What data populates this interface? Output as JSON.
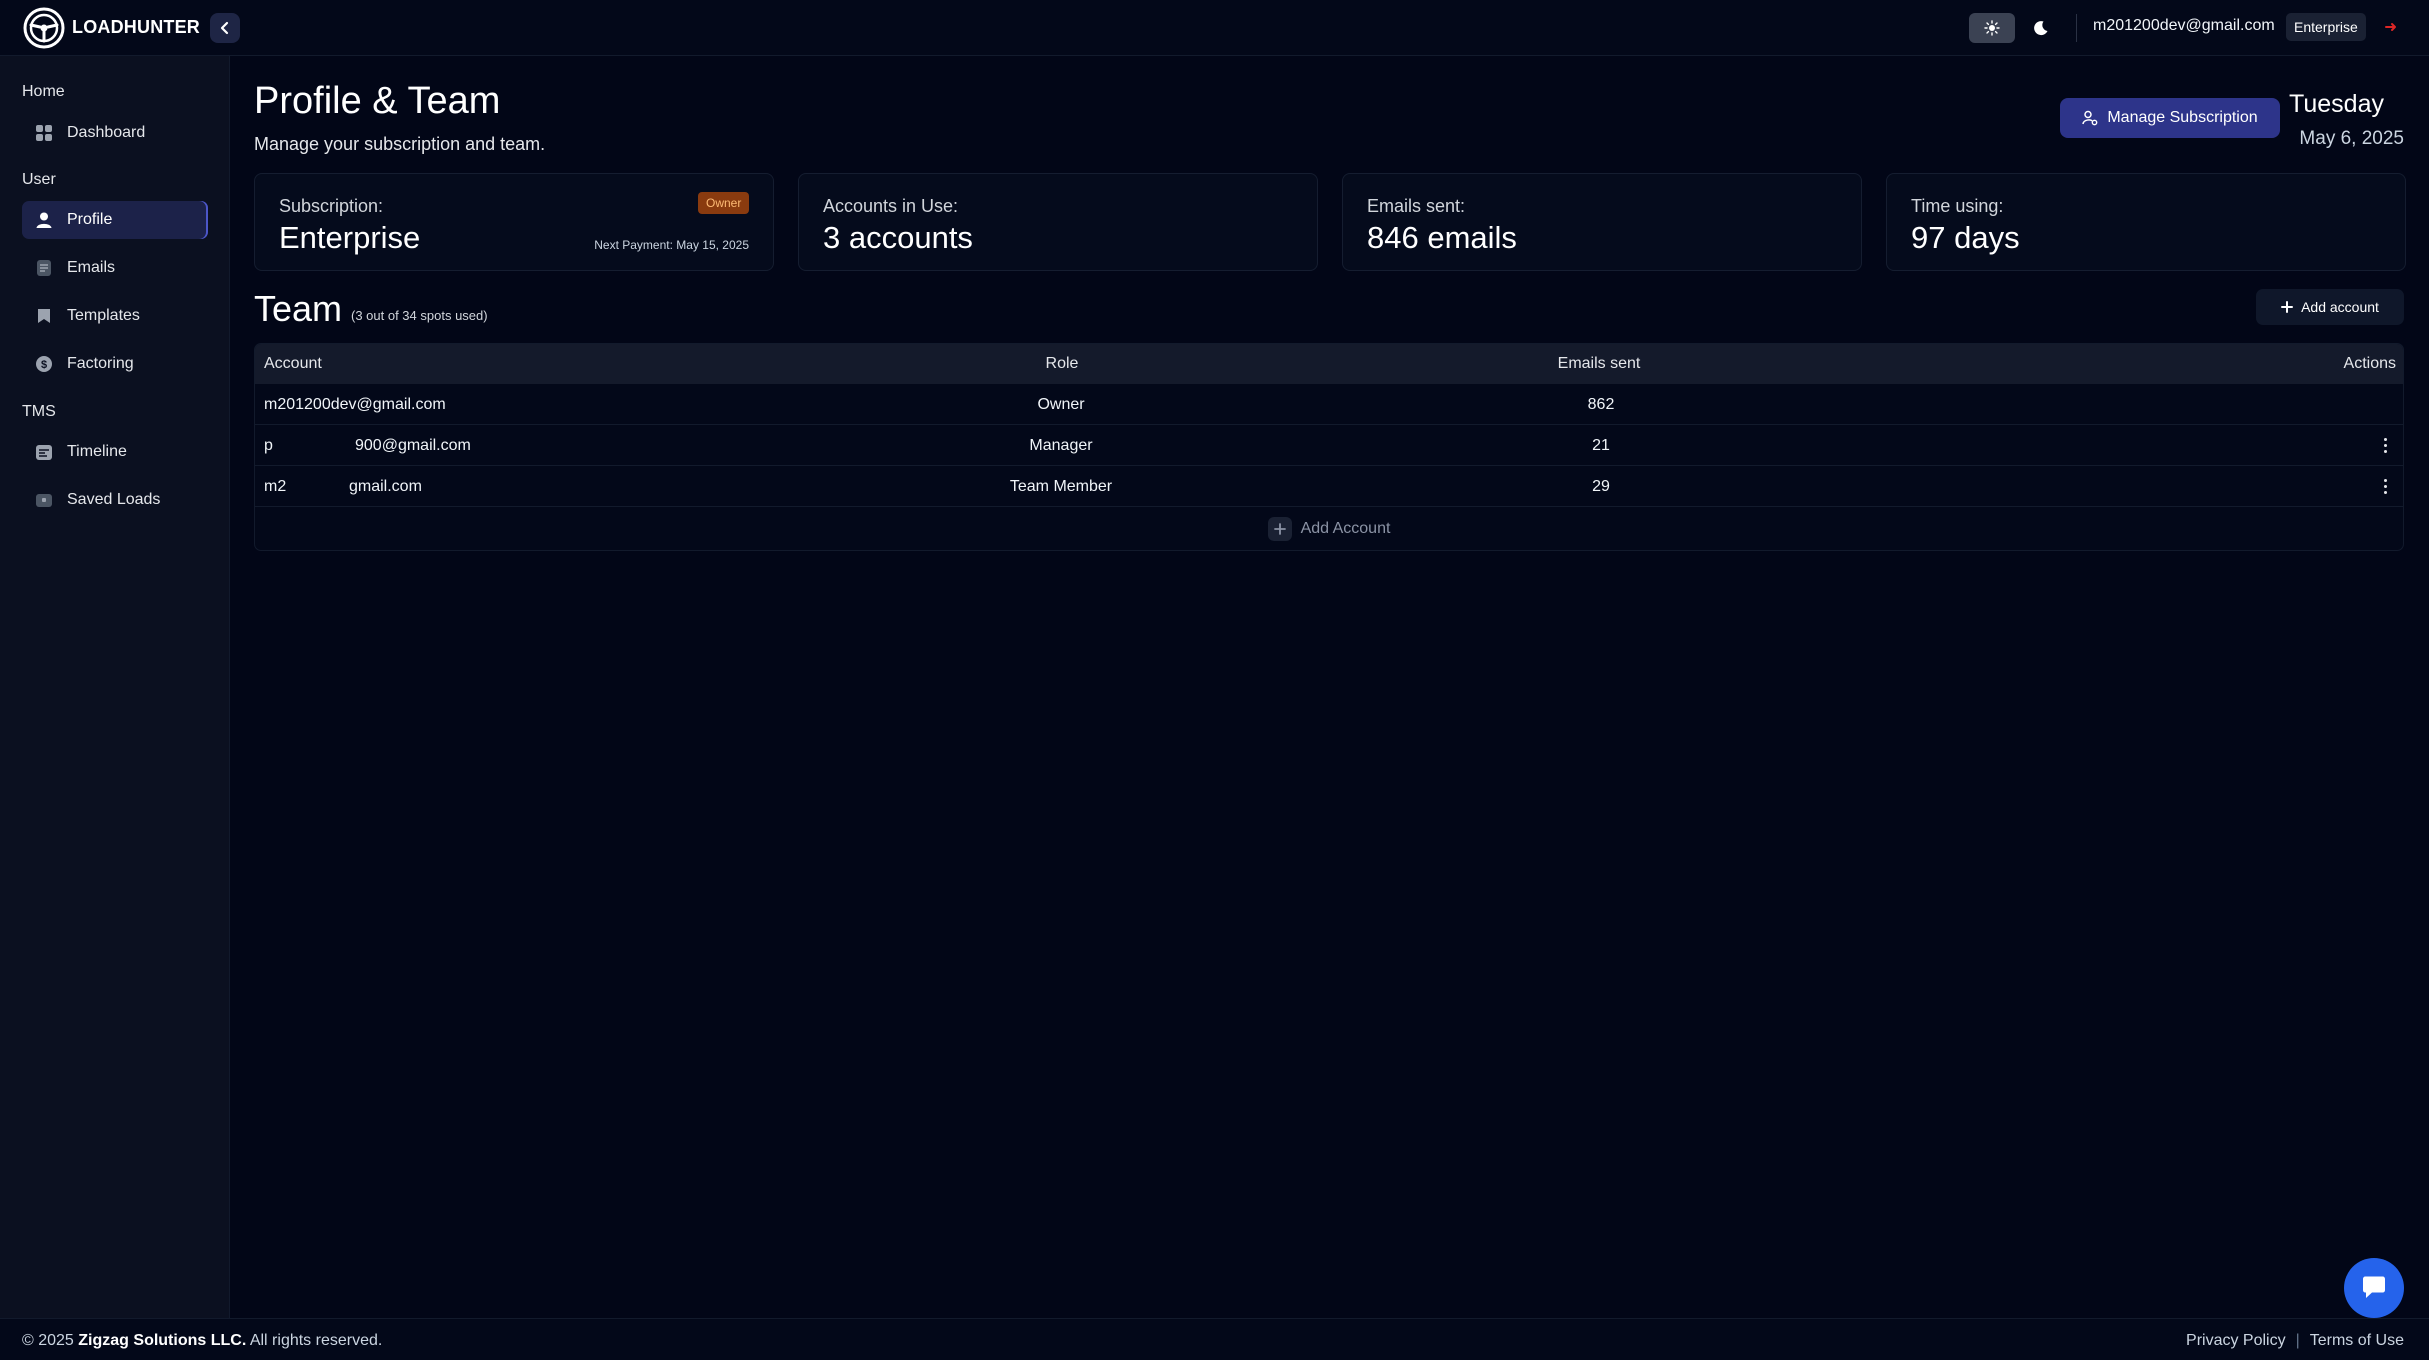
{
  "header": {
    "brand": "LOADHUNTER",
    "user_email": "m201200dev@gmail.com",
    "plan_badge": "Enterprise"
  },
  "sidebar": {
    "sections": [
      {
        "title": "Home",
        "items": [
          {
            "label": "Dashboard",
            "icon": "grid-icon"
          }
        ]
      },
      {
        "title": "User",
        "items": [
          {
            "label": "Profile",
            "icon": "person-icon",
            "active": true
          },
          {
            "label": "Emails",
            "icon": "document-icon"
          },
          {
            "label": "Templates",
            "icon": "bookmark-icon"
          },
          {
            "label": "Factoring",
            "icon": "dollar-icon"
          }
        ]
      },
      {
        "title": "TMS",
        "items": [
          {
            "label": "Timeline",
            "icon": "calendar-icon"
          },
          {
            "label": "Saved Loads",
            "icon": "package-icon"
          }
        ]
      }
    ]
  },
  "page": {
    "title": "Profile & Team",
    "subtitle": "Manage your subscription and team.",
    "manage_button": "Manage Subscription",
    "date_day": "Tuesday",
    "date_full": "May 6, 2025"
  },
  "stats": {
    "subscription": {
      "label": "Subscription:",
      "value": "Enterprise",
      "badge": "Owner",
      "next_payment": "Next Payment: May 15, 2025"
    },
    "accounts": {
      "label": "Accounts in Use:",
      "value": "3 accounts"
    },
    "emails": {
      "label": "Emails sent:",
      "value": "846 emails"
    },
    "time": {
      "label": "Time using:",
      "value": "97 days"
    }
  },
  "team": {
    "title": "Team",
    "usage": "(3 out of 34 spots used)",
    "add_button": "Add account",
    "columns": [
      "Account",
      "Role",
      "Emails sent",
      "Actions"
    ],
    "rows": [
      {
        "account_prefix": "m201200dev@gmail.com",
        "account_suffix": "",
        "role": "Owner",
        "emails": "862",
        "has_actions": false
      },
      {
        "account_prefix": "p",
        "account_suffix": "900@gmail.com",
        "role": "Manager",
        "emails": "21",
        "has_actions": true
      },
      {
        "account_prefix": "m2",
        "account_suffix": "gmail.com",
        "role": "Team Member",
        "emails": "29",
        "has_actions": true
      }
    ],
    "add_row_label": "Add Account"
  },
  "footer": {
    "copyright_prefix": "© 2025",
    "company": "Zigzag Solutions LLC.",
    "copyright_suffix": "All rights reserved.",
    "privacy": "Privacy Policy",
    "separator": "|",
    "terms": "Terms of Use"
  },
  "colors": {
    "background": "#020617",
    "sidebar": "#0b1020",
    "accent": "#2d348a",
    "owner_badge": "#8a3b0f",
    "chat": "#2563eb",
    "logout": "#dc2626"
  }
}
